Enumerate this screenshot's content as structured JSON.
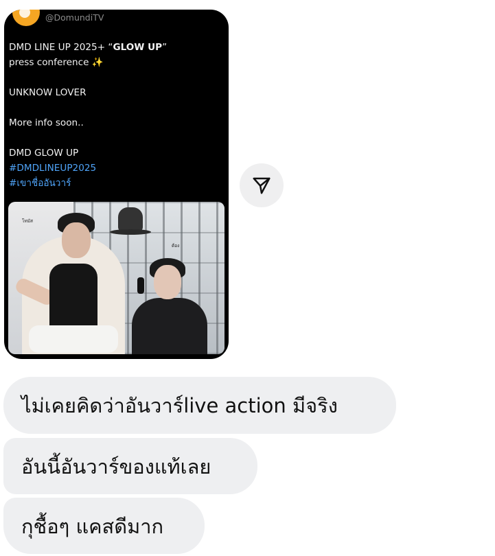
{
  "shared_post": {
    "handle": "@DomundiTV",
    "lines": [
      {
        "pre": "DMD LINE UP 2025+ “",
        "bold": "GLOW UP",
        "post": "”"
      },
      {
        "pre": "press conference ✨",
        "bold": "",
        "post": ""
      }
    ],
    "line_unknow": "UNKNOW LOVER",
    "line_info": "More info soon..",
    "line_glow": "DMD GLOW UP",
    "hashtag_1": "#DMDLINEUP2025",
    "hashtag_2": "#เขาชื่ออันวาร์",
    "photo": {
      "name_1": "โทมัส",
      "name_2": "ต้อง"
    }
  },
  "share_button": {
    "icon": "send-icon"
  },
  "messages": [
    "ไม่เคยคิดว่าอันวาร์live action มีจริง",
    "อันนี้อันวาร์ของแท้เลย",
    "กุชื้อๆ แคสดีมาก"
  ],
  "colors": {
    "card_bg": "#000000",
    "hashtag": "#4fa3f7",
    "bubble_bg": "#eeeff1",
    "avatar": "#f5a623"
  }
}
